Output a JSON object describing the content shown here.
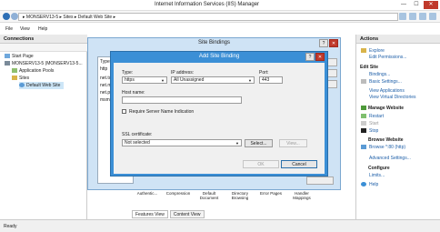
{
  "window": {
    "title": "Internet Information Services (IIS) Manager",
    "minimize": "—",
    "maximize": "☐",
    "close": "✕"
  },
  "address": {
    "path": "▸  MONSERV13-5  ▸  Sites  ▸  Default Web Site  ▸"
  },
  "menu": [
    "File",
    "View",
    "Help"
  ],
  "connections": {
    "title": "Connections",
    "tree": [
      "Start Page",
      "MONSERV13-5 (MONSERV13-5...",
      "Application Pools",
      "Sites",
      "Default Web Site"
    ]
  },
  "site_bindings": {
    "title": "Site Bindings",
    "help_button": "?",
    "close_button": "✕",
    "list_rows": [
      "Type",
      "http",
      "net.tc",
      "net.ms",
      "net.p",
      "msmq"
    ]
  },
  "add_binding": {
    "title": "Add Site Binding",
    "help_button": "?",
    "close_button": "✕",
    "type_label": "Type:",
    "type_value": "https",
    "ip_label": "IP address:",
    "ip_value": "All Unassigned",
    "port_label": "Port:",
    "port_value": "443",
    "host_label": "Host name:",
    "host_value": "",
    "sni_label": "Require Server Name Indication",
    "ssl_label": "SSL certificate:",
    "ssl_value": "Not selected",
    "select_button": "Select...",
    "view_button": "View...",
    "ok_button": "OK",
    "cancel_button": "Cancel"
  },
  "center": {
    "ribbon_items": [
      "Authentic...",
      "Compression",
      "Default Document",
      "Directory Browsing",
      "Error Pages",
      "Handler Mappings"
    ],
    "features_tab": "Features View",
    "content_tab": "Content View"
  },
  "actions": {
    "title": "Actions",
    "explore": "Explore",
    "edit_permissions": "Edit Permissions...",
    "edit_site": "Edit Site",
    "bindings": "Bindings...",
    "basic_settings": "Basic Settings...",
    "view_applications": "View Applications",
    "view_virtual_directories": "View Virtual Directories",
    "manage_website": "Manage Website",
    "restart": "Restart",
    "start": "Start",
    "stop": "Stop",
    "browse_website": "Browse Website",
    "browse_80": "Browse *:80 (http)",
    "advanced_settings": "Advanced Settings...",
    "configure": "Configure",
    "limits": "Limits...",
    "help": "Help"
  },
  "status": {
    "text": "Ready"
  },
  "colors": {
    "accent": "#3b8fd6",
    "link": "#1e5fa8",
    "close_red": "#c0392b"
  }
}
